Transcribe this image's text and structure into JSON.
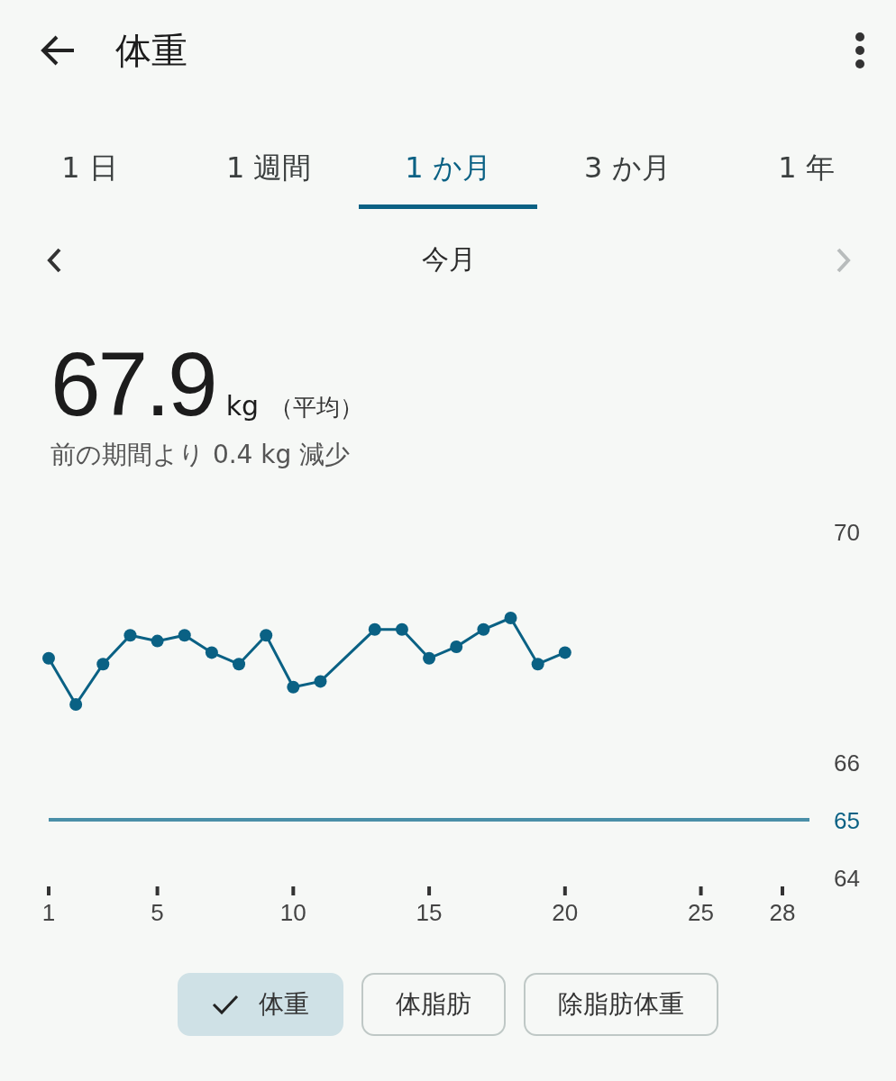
{
  "header": {
    "title": "体重"
  },
  "tabs": [
    {
      "label": "1 日",
      "selected": false
    },
    {
      "label": "1 週間",
      "selected": false
    },
    {
      "label": "1 か月",
      "selected": true
    },
    {
      "label": "3 か月",
      "selected": false
    },
    {
      "label": "1 年",
      "selected": false
    }
  ],
  "period": {
    "label": "今月",
    "prev_disabled": false,
    "next_disabled": true
  },
  "summary": {
    "value": "67.9",
    "unit": "kg",
    "note": "（平均）",
    "change": "前の期間より 0.4 kg 減少"
  },
  "chart_data": {
    "type": "line",
    "x": [
      1,
      2,
      3,
      4,
      5,
      6,
      7,
      8,
      9,
      10,
      11,
      13,
      14,
      15,
      16,
      17,
      18,
      19,
      20
    ],
    "series": [
      {
        "color": "#0a6184",
        "marker": "o",
        "values": [
          67.8,
          67.0,
          67.7,
          68.2,
          68.1,
          68.2,
          67.9,
          67.7,
          68.2,
          67.3,
          67.4,
          68.3,
          68.3,
          67.8,
          68.0,
          68.3,
          68.5,
          67.7,
          67.9
        ]
      }
    ],
    "xlim": [
      1,
      28
    ],
    "ylim": [
      64,
      70
    ],
    "xticks": [
      1,
      5,
      10,
      15,
      20,
      25,
      28
    ],
    "yticks": [
      64,
      66,
      70
    ],
    "ref_lines": [
      {
        "axis": "y",
        "value": 65,
        "label": "65",
        "color": "#4a8fa8"
      }
    ]
  },
  "chips": [
    {
      "label": "体重",
      "selected": true
    },
    {
      "label": "体脂肪",
      "selected": false
    },
    {
      "label": "除脂肪体重",
      "selected": false
    }
  ]
}
